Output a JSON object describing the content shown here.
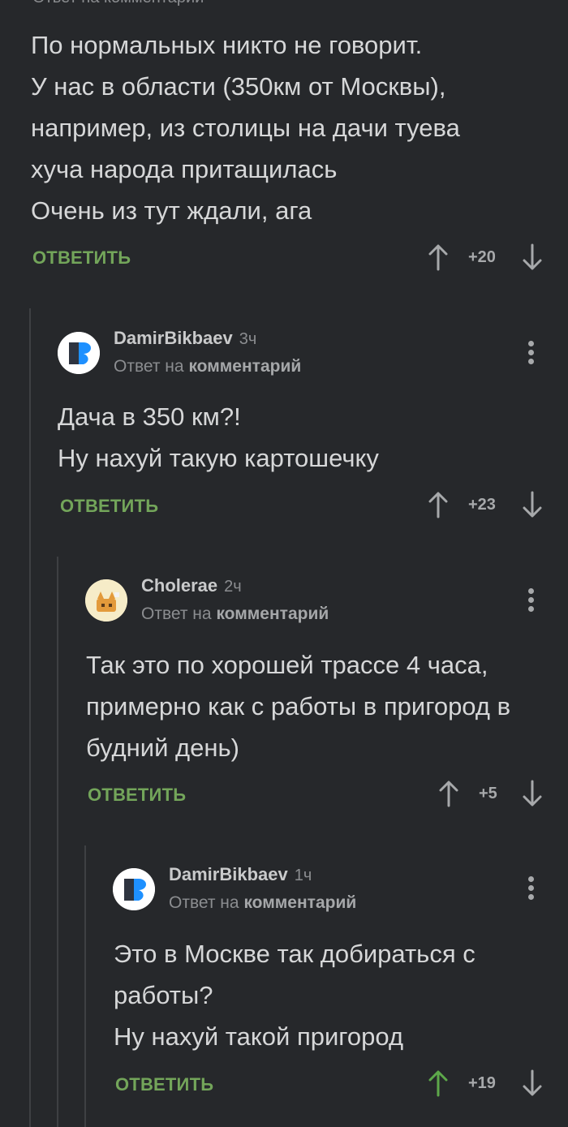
{
  "top_fragment": "Ответ на комментарий",
  "comments": [
    {
      "text": "По нормальных никто не говорит.\nУ нас в области (350км от Москвы), например, из столицы на дачи туева хуча народа притащилась\nОчень из тут ждали, ага",
      "reply": "ОТВЕТИТЬ",
      "rating": "+20"
    },
    {
      "user": "DamirBikbaev",
      "time": "3ч",
      "meta_prefix": "Ответ на",
      "meta_link": "комментарий",
      "text": "Дача в 350 км?!\nНу нахуй такую картошечку",
      "reply": "ОТВЕТИТЬ",
      "rating": "+23"
    },
    {
      "user": "Cholerae",
      "time": "2ч",
      "meta_prefix": "Ответ на",
      "meta_link": "комментарий",
      "text": "Так это по хорошей трассе 4 часа, примерно как с работы в пригород в будний день)",
      "reply": "ОТВЕТИТЬ",
      "rating": "+5"
    },
    {
      "user": "DamirBikbaev",
      "time": "1ч",
      "meta_prefix": "Ответ на",
      "meta_link": "комментарий",
      "text": "Это в Москве так добираться с работы?\nНу нахуй такой пригород",
      "reply": "ОТВЕТИТЬ",
      "rating": "+19"
    }
  ],
  "icons": {
    "upvote": "arrow-up-icon",
    "upvote_active": "arrow-up-icon",
    "downvote": "arrow-down-icon",
    "more": "more-vertical-icon"
  },
  "colors": {
    "background": "#26282b",
    "reply_green": "#73a55a",
    "thread_line": "#3e4043",
    "active_vote": "#5da84a"
  }
}
